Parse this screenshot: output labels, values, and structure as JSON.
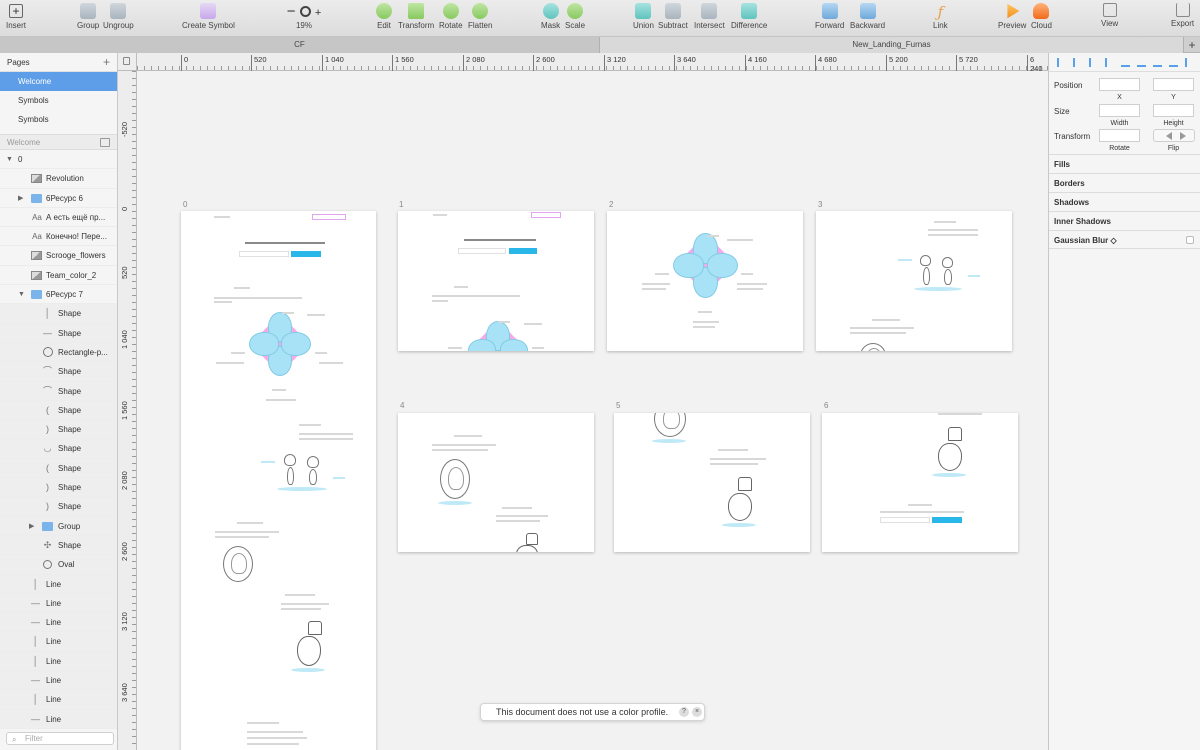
{
  "toolbar": {
    "insert": "Insert",
    "group": "Group",
    "ungroup": "Ungroup",
    "create_symbol": "Create Symbol",
    "zoom_minus": "−",
    "zoom_plus": "+",
    "zoom_level": "19%",
    "edit": "Edit",
    "transform": "Transform",
    "rotate": "Rotate",
    "flatten": "Flatten",
    "mask": "Mask",
    "scale": "Scale",
    "union": "Union",
    "subtract": "Subtract",
    "intersect": "Intersect",
    "difference": "Difference",
    "forward": "Forward",
    "backward": "Backward",
    "link": "Link",
    "preview": "Preview",
    "cloud": "Cloud",
    "view": "View",
    "export": "Export"
  },
  "tabs": {
    "left": "CF",
    "right": "New_Landing_Furnas",
    "add": "+"
  },
  "pages": {
    "title": "Pages",
    "add": "+",
    "items": [
      {
        "label": "Welcome"
      },
      {
        "label": "Symbols"
      },
      {
        "label": "Symbols"
      }
    ]
  },
  "layers": {
    "header": "Welcome",
    "items": [
      {
        "label": "0"
      },
      {
        "label": "Revolution"
      },
      {
        "label": "6Ресурс 6"
      },
      {
        "label": "А есть ещё пр..."
      },
      {
        "label": "Конечно! Пере..."
      },
      {
        "label": "Scrooge_flowers"
      },
      {
        "label": "Team_color_2"
      },
      {
        "label": "6Ресурс 7"
      },
      {
        "label": "Shape"
      },
      {
        "label": "Shape"
      },
      {
        "label": "Rectangle-p..."
      },
      {
        "label": "Shape"
      },
      {
        "label": "Shape"
      },
      {
        "label": "Shape"
      },
      {
        "label": "Shape"
      },
      {
        "label": "Shape"
      },
      {
        "label": "Shape"
      },
      {
        "label": "Shape"
      },
      {
        "label": "Shape"
      },
      {
        "label": "Group"
      },
      {
        "label": "Shape"
      },
      {
        "label": "Oval"
      },
      {
        "label": "Line"
      },
      {
        "label": "Line"
      },
      {
        "label": "Line"
      },
      {
        "label": "Line"
      },
      {
        "label": "Line"
      },
      {
        "label": "Line"
      },
      {
        "label": "Line"
      },
      {
        "label": "Line"
      }
    ],
    "filter_placeholder": "Filter"
  },
  "ruler": {
    "x_ticks": [
      "0",
      "520",
      "1 040",
      "1 560",
      "2 080",
      "2 600",
      "3 120",
      "3 640",
      "4 160",
      "4 680",
      "5 200",
      "5 720",
      "6 240"
    ],
    "y_ticks": [
      "-520",
      "0",
      "520",
      "1 040",
      "1 560",
      "2 080",
      "2 600",
      "3 120",
      "3 640"
    ]
  },
  "artboards": {
    "labels": [
      "0",
      "1",
      "2",
      "3",
      "4",
      "5",
      "6"
    ]
  },
  "toast": {
    "message": "This document does not use a color profile.",
    "help": "?",
    "close": "×"
  },
  "inspector": {
    "position": "Position",
    "x": "X",
    "y": "Y",
    "size": "Size",
    "width": "Width",
    "height": "Height",
    "transform": "Transform",
    "rotate": "Rotate",
    "flip": "Flip",
    "sections": {
      "fills": "Fills",
      "borders": "Borders",
      "shadows": "Shadows",
      "inner_shadows": "Inner Shadows",
      "gaussian_blur": "Gaussian Blur ◇"
    }
  },
  "colors": {
    "selection": "#5e9de8",
    "accent_button": "#29b6e8",
    "petal": "#a8e2f7",
    "petal_pink": "#f3a9ea"
  }
}
